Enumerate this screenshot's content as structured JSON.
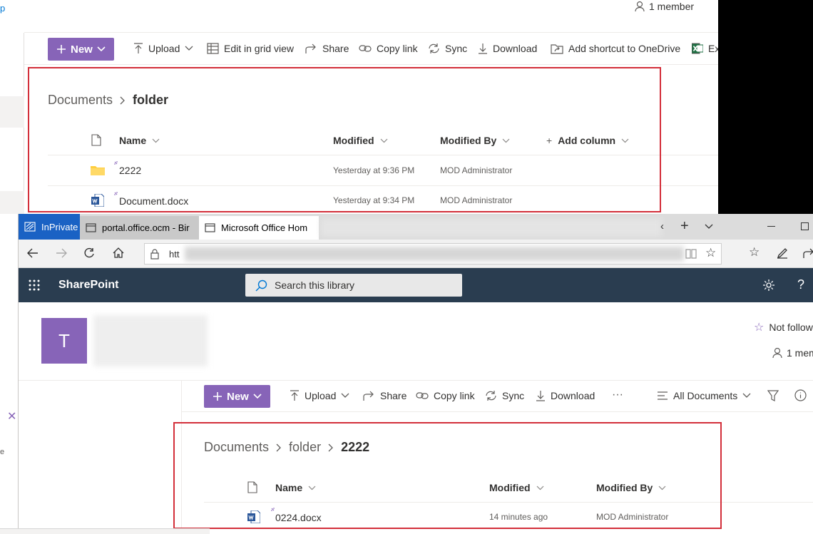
{
  "top": {
    "header_back_letter": "p",
    "members": "1 member",
    "command_bar": {
      "new": "New",
      "upload": "Upload",
      "edit_grid": "Edit in grid view",
      "share": "Share",
      "copy_link": "Copy link",
      "sync": "Sync",
      "download": "Download",
      "add_shortcut": "Add shortcut to OneDrive",
      "export_truncated": "Ex"
    },
    "breadcrumb": {
      "root": "Documents",
      "current": "folder"
    },
    "columns": {
      "name": "Name",
      "modified": "Modified",
      "modified_by": "Modified By",
      "add_column": "Add column"
    },
    "rows": [
      {
        "name": "2222",
        "modified": "Yesterday at 9:36 PM",
        "modified_by": "MOD Administrator"
      },
      {
        "name": "Document.docx",
        "modified": "Yesterday at 9:34 PM",
        "modified_by": "MOD Administrator"
      }
    ]
  },
  "browser": {
    "tabs": [
      {
        "label": "InPrivate"
      },
      {
        "label": "portal.office.ocm - Bir"
      },
      {
        "label": "Microsoft Office Hom"
      }
    ],
    "address_prefix": "htt",
    "app_name": "SharePoint",
    "search_placeholder": "Search this library",
    "site_letter": "T",
    "not_following": "Not follow",
    "members": "1 mem",
    "command_bar": {
      "new": "New",
      "upload": "Upload",
      "share": "Share",
      "copy_link": "Copy link",
      "sync": "Sync",
      "download": "Download",
      "more": "···",
      "view": "All Documents"
    },
    "breadcrumb": {
      "root": "Documents",
      "middle": "folder",
      "current": "2222"
    },
    "columns": {
      "name": "Name",
      "modified": "Modified",
      "modified_by": "Modified By"
    },
    "rows": [
      {
        "name": "0224.docx",
        "modified": "14 minutes ago",
        "modified_by": "MOD Administrator"
      }
    ],
    "left_letter": "e"
  },
  "colors": {
    "accent": "#8764b8",
    "header": "#2a3d50",
    "highlight": "#d32f3a"
  }
}
